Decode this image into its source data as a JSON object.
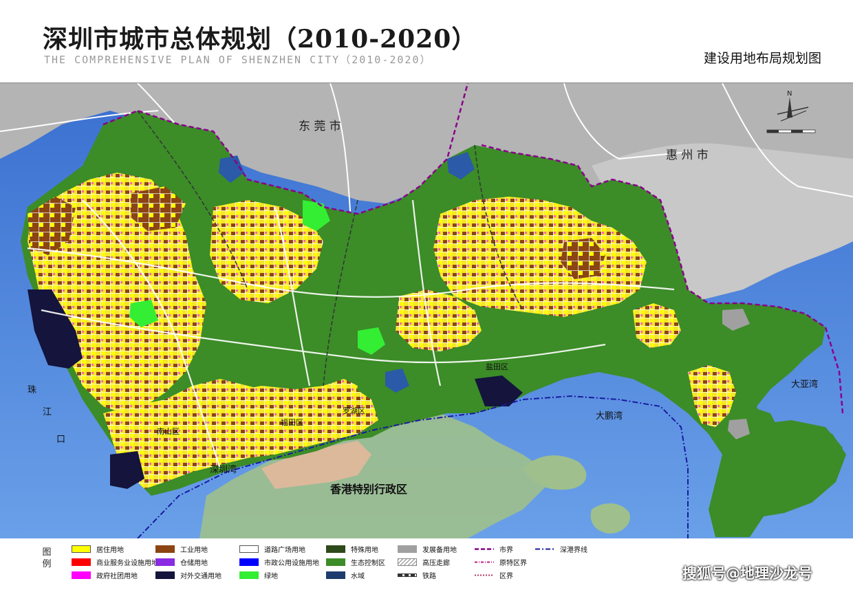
{
  "header": {
    "title": "深圳市城市总体规划（2010-2020）",
    "subtitle": "THE COMPREHENSIVE PLAN OF SHENZHEN CITY（2010-2020）",
    "map_title": "建设用地布局规划图"
  },
  "map": {
    "regions": {
      "dongguan": "东 莞 市",
      "huizhou": "惠 州 市",
      "hongkong": "香港特别行政区",
      "futian": "福田区",
      "luohu": "罗湖区",
      "yantian": "盐田区",
      "nanshan": "南山区"
    },
    "water": {
      "pearl_river": "珠",
      "pearl_river_2": "江",
      "pearl_river_3": "口",
      "shenzhen_bay": "深圳湾",
      "dapeng_bay": "大鹏湾",
      "daya_bay": "大亚湾"
    },
    "compass": "N"
  },
  "legend": {
    "heading": "图例",
    "items": [
      {
        "label": "居住用地",
        "color": "#ffff00"
      },
      {
        "label": "商业服务业设施用地",
        "color": "#ff0000"
      },
      {
        "label": "政府社团用地",
        "color": "#ff00ff"
      },
      {
        "label": "工业用地",
        "color": "#8b4513"
      },
      {
        "label": "仓储用地",
        "color": "#8a2be2"
      },
      {
        "label": "对外交通用地",
        "color": "#14143c"
      },
      {
        "label": "道路广场用地",
        "color": "#ffffff"
      },
      {
        "label": "市政公用设施用地",
        "color": "#0000ff"
      },
      {
        "label": "绿地",
        "color": "#33ee33"
      },
      {
        "label": "特殊用地",
        "color": "#2e4a1a"
      },
      {
        "label": "生态控制区",
        "color": "#3c8c28"
      },
      {
        "label": "水域",
        "color": "#1e3c6e"
      },
      {
        "label": "发展备用地",
        "color": "#a0a0a0"
      },
      {
        "label": "高压走廊",
        "color": "hatch"
      },
      {
        "label": "铁路",
        "color": "rail"
      },
      {
        "label": "市界",
        "color": "#8b008b"
      },
      {
        "label": "原特区界",
        "color": "#c71585"
      },
      {
        "label": "区界",
        "color": "#b03060"
      },
      {
        "label": "深港界线",
        "color": "#1a1aa0"
      }
    ]
  },
  "watermark": "搜狐号@地理沙龙号"
}
